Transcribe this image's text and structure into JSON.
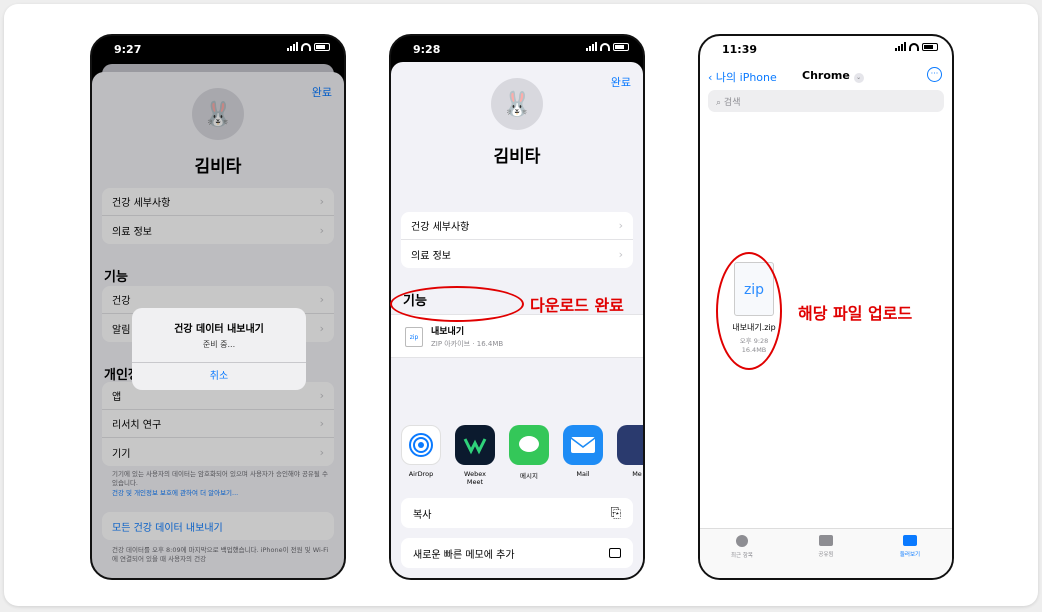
{
  "phone1": {
    "time": "9:27",
    "done": "완료",
    "name": "김비타",
    "rows1": [
      "건강 세부사항",
      "의료 정보"
    ],
    "section_feature": "기능",
    "rows2": [
      "건강",
      "알림"
    ],
    "alert": {
      "title": "건강 데이터 내보내기",
      "sub": "준비 중...",
      "cancel": "취소"
    },
    "section_privacy": "개인정보 보호",
    "rows3": [
      "앱",
      "리서치 연구",
      "기기"
    ],
    "foot1": "기기에 있는 사용자의 데이터는 암호화되어 있으며 사용자가 승인해야 공유될 수 있습니다.",
    "foot1_link": "건강 및 개인정보 보호에 관하여 더 알아보기...",
    "export_button": "모든 건강 데이터 내보내기",
    "foot2": "건강 데이터를 오후 8:09에 마지막으로 백업했습니다. iPhone이 전원 및 Wi-Fi에 연결되어 있을 때 사용자의 건강"
  },
  "phone2": {
    "time": "9:28",
    "done": "완료",
    "name": "김비타",
    "rows1": [
      "건강 세부사항",
      "의료 정보"
    ],
    "section_feature": "기능",
    "file_name": "내보내기",
    "file_meta": "ZIP 아카이브 · 16.4MB",
    "zip_label": "zip",
    "apps": [
      "AirDrop",
      "Webex Meet",
      "메시지",
      "Mail",
      "Me"
    ],
    "actions": [
      "복사",
      "새로운 빠른 메모에 추가"
    ],
    "annotation": "다운로드 완료"
  },
  "phone3": {
    "time": "11:39",
    "back": "나의 iPhone",
    "title": "Chrome",
    "search_placeholder": "검색",
    "file_icon_label": "zip",
    "file_name": "내보내기.zip",
    "file_time": "오후 9:28",
    "file_size": "16.4MB",
    "annotation": "해당 파일 업로드",
    "tabs": [
      "최근 항목",
      "공유됨",
      "둘러보기"
    ]
  },
  "colors": {
    "accent": "#0a7aff",
    "annotation": "#e00000"
  }
}
